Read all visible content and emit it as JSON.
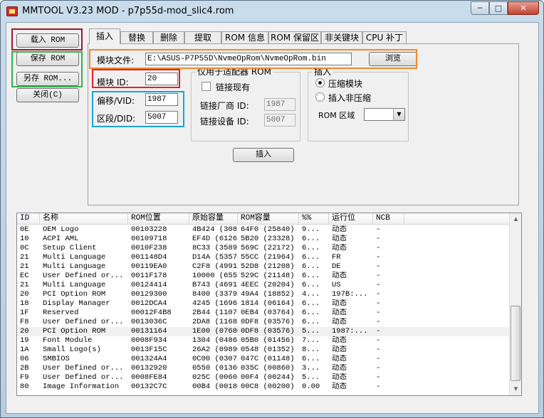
{
  "window": {
    "title": "MMTOOL V3.23 MOD - p7p55d-mod_slic4.rom",
    "minimize_glyph": "─",
    "maximize_glyph": "□",
    "close_glyph": "✕"
  },
  "buttons": {
    "load_rom": "载入 ROM",
    "save_rom": "保存 ROM",
    "save_as_rom": "另存 ROM...",
    "close": "关闭(C)",
    "browse": "浏览",
    "insert": "插入"
  },
  "tabs": [
    {
      "label": "插入"
    },
    {
      "label": "替换"
    },
    {
      "label": "删除"
    },
    {
      "label": "提取"
    },
    {
      "label": "ROM 信息"
    },
    {
      "label": "ROM 保留区"
    },
    {
      "label": "非关键块"
    },
    {
      "label": "CPU 补丁"
    }
  ],
  "insert_panel": {
    "module_file_label": "模块文件:",
    "module_file_value": "E:\\ASUS-P7P55D\\NvmeOpRom\\NvmeOpRom.bin",
    "module_id_label": "模块 ID:",
    "module_id_value": "20",
    "vid_label": "偏移/VID:",
    "vid_value": "1987",
    "did_label": "区段/DID:",
    "did_value": "5007",
    "adapter_group_title": "仅用于适配器 ROM",
    "link_existing_label": "链接现有",
    "link_vendor_id_label": "链接厂商 ID:",
    "link_vendor_id_value": "1987",
    "link_device_id_label": "链接设备 ID:",
    "link_device_id_value": "5007",
    "insert_group_title": "插入",
    "compressed_label": "压缩模块",
    "uncompressed_label": "插入非压缩",
    "rom_area_label": "ROM 区域",
    "rom_area_value": ""
  },
  "table": {
    "columns": [
      "ID",
      "名称",
      "ROM位置",
      "原始容量",
      "ROM容量",
      "%%",
      "运行位",
      "NCB"
    ],
    "rows": [
      [
        "0E",
        "OEM Logo",
        "00103228",
        "4B424 (308...",
        "64F0 (25840)",
        "9...",
        "动态",
        "-"
      ],
      [
        "10",
        "ACPI AML",
        "00109718",
        "EF4D (61261)",
        "5B20 (23328)",
        "6...",
        "动态",
        "-"
      ],
      [
        "0C",
        "Setup Client",
        "0010F238",
        "8C33 (35891)",
        "569C (22172)",
        "6...",
        "动态",
        "-"
      ],
      [
        "21",
        "Multi Language",
        "001148D4",
        "D14A (53578)",
        "55CC (21964)",
        "6...",
        "FR",
        "-"
      ],
      [
        "21",
        "Multi Language",
        "00119EA0",
        "C2F8 (49912)",
        "52D8 (21208)",
        "6...",
        "DE",
        "-"
      ],
      [
        "EC",
        "User Defined or...",
        "0011F178",
        "10000 (65536)",
        "529C (21148)",
        "6...",
        "动态",
        "-"
      ],
      [
        "21",
        "Multi Language",
        "00124414",
        "B743 (46915)",
        "4EEC (20204)",
        "6...",
        "US",
        "-"
      ],
      [
        "20",
        "PCI Option ROM",
        "00129300",
        "8400 (33792)",
        "49A4 (18852)",
        "4...",
        "197B:...",
        "-"
      ],
      [
        "18",
        "Display Manager",
        "0012DCA4",
        "4245 (16965)",
        "1814 (06164)",
        "6...",
        "动态",
        "-"
      ],
      [
        "1F",
        "Reserved",
        "00012F4B8",
        "2B44 (11076)",
        "0EB4 (03764)",
        "6...",
        "动态",
        "-"
      ],
      [
        "F8",
        "User Defined or...",
        "0013036C",
        "2DA8 (11688)",
        "0DF8 (03576)",
        "6...",
        "动态",
        "-"
      ],
      [
        "20",
        "PCI Option ROM",
        "00131164",
        "1E00 (07680)",
        "0DF8 (03576)",
        "5...",
        "1987:...",
        "-"
      ],
      [
        "19",
        "Font Module",
        "0008F934",
        "1304 (04868)",
        "05B0 (01456)",
        "7...",
        "动态",
        "-"
      ],
      [
        "1A",
        "Small Logo(s)",
        "0013F15C",
        "26A2 (09890)",
        "0548 (01352)",
        "8...",
        "动态",
        "-"
      ],
      [
        "06",
        "SMBIOS",
        "001324A4",
        "0C00 (03072)",
        "047C (01148)",
        "6...",
        "动态",
        "-"
      ],
      [
        "2B",
        "User Defined or...",
        "00132920",
        "0550 (01360)",
        "035C (00860)",
        "3...",
        "动态",
        "-"
      ],
      [
        "F9",
        "User Defined or...",
        "0008FE84",
        "025C (00604)",
        "00F4 (00244)",
        "5...",
        "动态",
        "-"
      ],
      [
        "80",
        "Image Information",
        "00132C7C",
        "00B4 (00180)",
        "00C8 (00200)",
        "0.00",
        "动态",
        "-"
      ]
    ],
    "selected_row": 11
  },
  "colors": {
    "highlight_load": "#9b1b2a",
    "highlight_save": "#2fb34a",
    "highlight_module_file": "#f5872a",
    "highlight_module_id": "#e0212e",
    "highlight_vid_did": "#1ea1dc"
  }
}
